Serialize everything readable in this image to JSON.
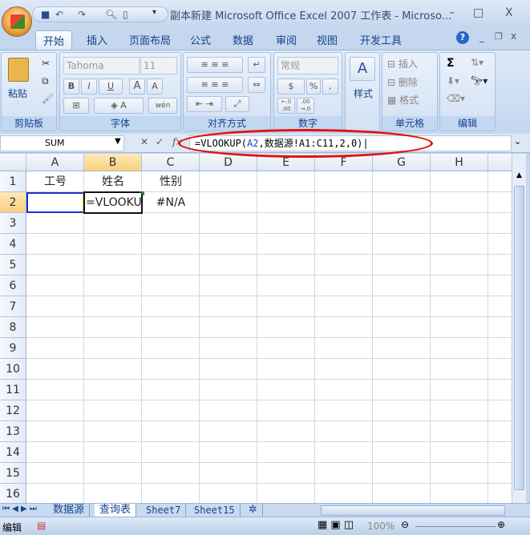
{
  "window": {
    "title": "副本新建 Microsoft Office Excel 2007 工作表 - Microso...",
    "minimize": "–",
    "maximize": "□",
    "close": "X"
  },
  "qat": {
    "save": "save-icon",
    "undo": "↶",
    "redo": "↷",
    "more": "▾"
  },
  "ribbon_tabs": [
    "开始",
    "插入",
    "页面布局",
    "公式",
    "数据",
    "审阅",
    "视图",
    "开发工具"
  ],
  "ribbon": {
    "clipboard": {
      "label": "剪贴板",
      "paste": "粘贴"
    },
    "font": {
      "label": "字体",
      "font_name": "Tahoma",
      "font_size": "11",
      "bold": "B",
      "italic": "I",
      "underline": "U",
      "grow": "A",
      "shrink": "A",
      "phonetic": "wén"
    },
    "alignment": {
      "label": "对齐方式"
    },
    "number": {
      "label": "数字",
      "format": "常规",
      "percent": "%",
      "comma": ",",
      "inc": "←.0 .00",
      "dec": ".00 →.0"
    },
    "styles": {
      "label": "样式"
    },
    "cells": {
      "label": "单元格",
      "insert": "插入",
      "delete": "删除",
      "format": "格式"
    },
    "editing": {
      "label": "编辑",
      "sum": "Σ"
    }
  },
  "formula_bar": {
    "name_box": "SUM",
    "fx": "fx",
    "formula_prefix": "=VLOOKUP(",
    "formula_ref": "A2",
    "formula_rest": ",数据源!A1:C11,2,0)"
  },
  "columns": [
    "A",
    "B",
    "C",
    "D",
    "E",
    "F",
    "G",
    "H"
  ],
  "rows": [
    "1",
    "2",
    "3",
    "4",
    "5",
    "6",
    "7",
    "8",
    "9",
    "10",
    "11",
    "12",
    "13",
    "14",
    "15",
    "16"
  ],
  "cells": {
    "A1": "工号",
    "B1": "姓名",
    "C1": "性别",
    "B2": "=VLOOKU",
    "C2": "#N/A"
  },
  "sheets": [
    "数据源",
    "查询表",
    "Sheet7",
    "Sheet15"
  ],
  "status": {
    "mode": "编辑",
    "zoom": "100%"
  },
  "colors": {
    "accent": "#15428b",
    "annotation": "#e41010"
  }
}
